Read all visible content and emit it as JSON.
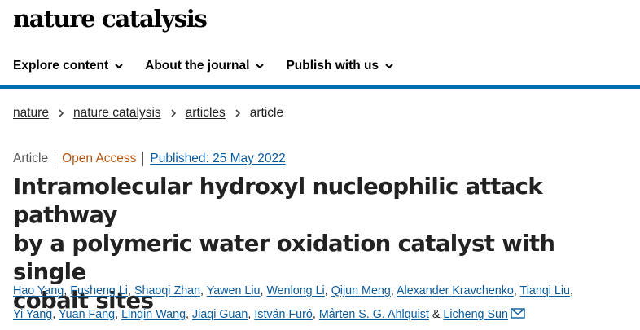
{
  "site": {
    "logo": "nature catalysis"
  },
  "nav": {
    "items": [
      {
        "label": "Explore content"
      },
      {
        "label": "About the journal"
      },
      {
        "label": "Publish with us"
      }
    ]
  },
  "breadcrumb": {
    "items": [
      {
        "label": "nature"
      },
      {
        "label": "nature catalysis"
      },
      {
        "label": "articles"
      }
    ],
    "current": "article"
  },
  "meta": {
    "type": "Article",
    "open_access": "Open Access",
    "published": "Published: 25 May 2022"
  },
  "article": {
    "title_line1": "Intramolecular hydroxyl nucleophilic attack pathway",
    "title_line2": "by a polymeric water oxidation catalyst with single",
    "title_line3": "cobalt sites"
  },
  "authors": [
    "Hao Yang",
    "Fusheng Li",
    "Shaoqi Zhan",
    "Yawen Liu",
    "Wenlong Li",
    "Qijun Meng",
    "Alexander Kravchenko",
    "Tianqi Liu",
    "Yi Yang",
    "Yuan Fang",
    "Linqin Wang",
    "Jiaqi Guan",
    "István Furó",
    "Mårten S. G. Ahlquist",
    "Licheng Sun"
  ],
  "authors_separator": ",",
  "authors_last_joiner": "&",
  "colors": {
    "accent_rule": "#0070a8",
    "link": "#0a5a9c",
    "open_access": "#b4550d"
  },
  "icons": {
    "nav_chevron": "chevron-down-icon",
    "breadcrumb_sep": "chevron-right-icon",
    "corresponding": "mail-icon"
  }
}
